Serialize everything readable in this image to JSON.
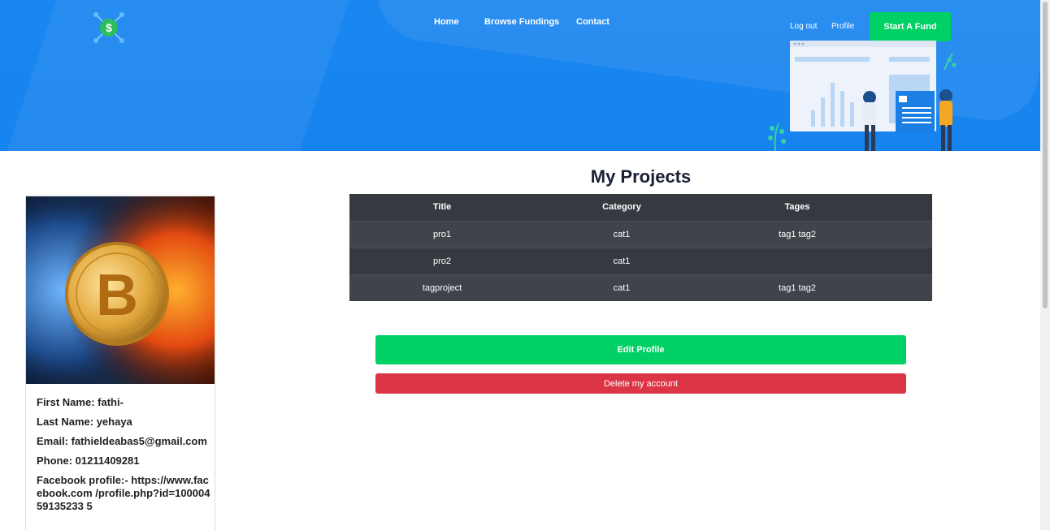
{
  "nav": {
    "home": "Home",
    "browse": "Browse Fundings",
    "contact": "Contact",
    "logout": "Log out",
    "profile": "Profile",
    "start_fund": "Start A Fund"
  },
  "profile_card": {
    "first_name": "First Name: fathi-",
    "last_name": "Last Name: yehaya",
    "email": "Email: fathieldeabas5@gmail.com",
    "phone": "Phone: 01211409281",
    "facebook": "Facebook profile:- https://www.facebook.com /profile.php?id=10000459135233 5"
  },
  "projects": {
    "title": "My Projects",
    "columns": [
      "Title",
      "Category",
      "Tages"
    ],
    "rows": [
      {
        "title": "pro1",
        "category": "cat1",
        "tags": "tag1 tag2"
      },
      {
        "title": "pro2",
        "category": "cat1",
        "tags": ""
      },
      {
        "title": "tagproject",
        "category": "cat1",
        "tags": "tag1 tag2"
      }
    ]
  },
  "actions": {
    "edit": "Edit Profile",
    "delete": "Delete my account"
  },
  "colors": {
    "hero": "#1a86f0",
    "accent_green": "#00d164",
    "danger": "#dc3545",
    "table_dark": "#343a40"
  }
}
